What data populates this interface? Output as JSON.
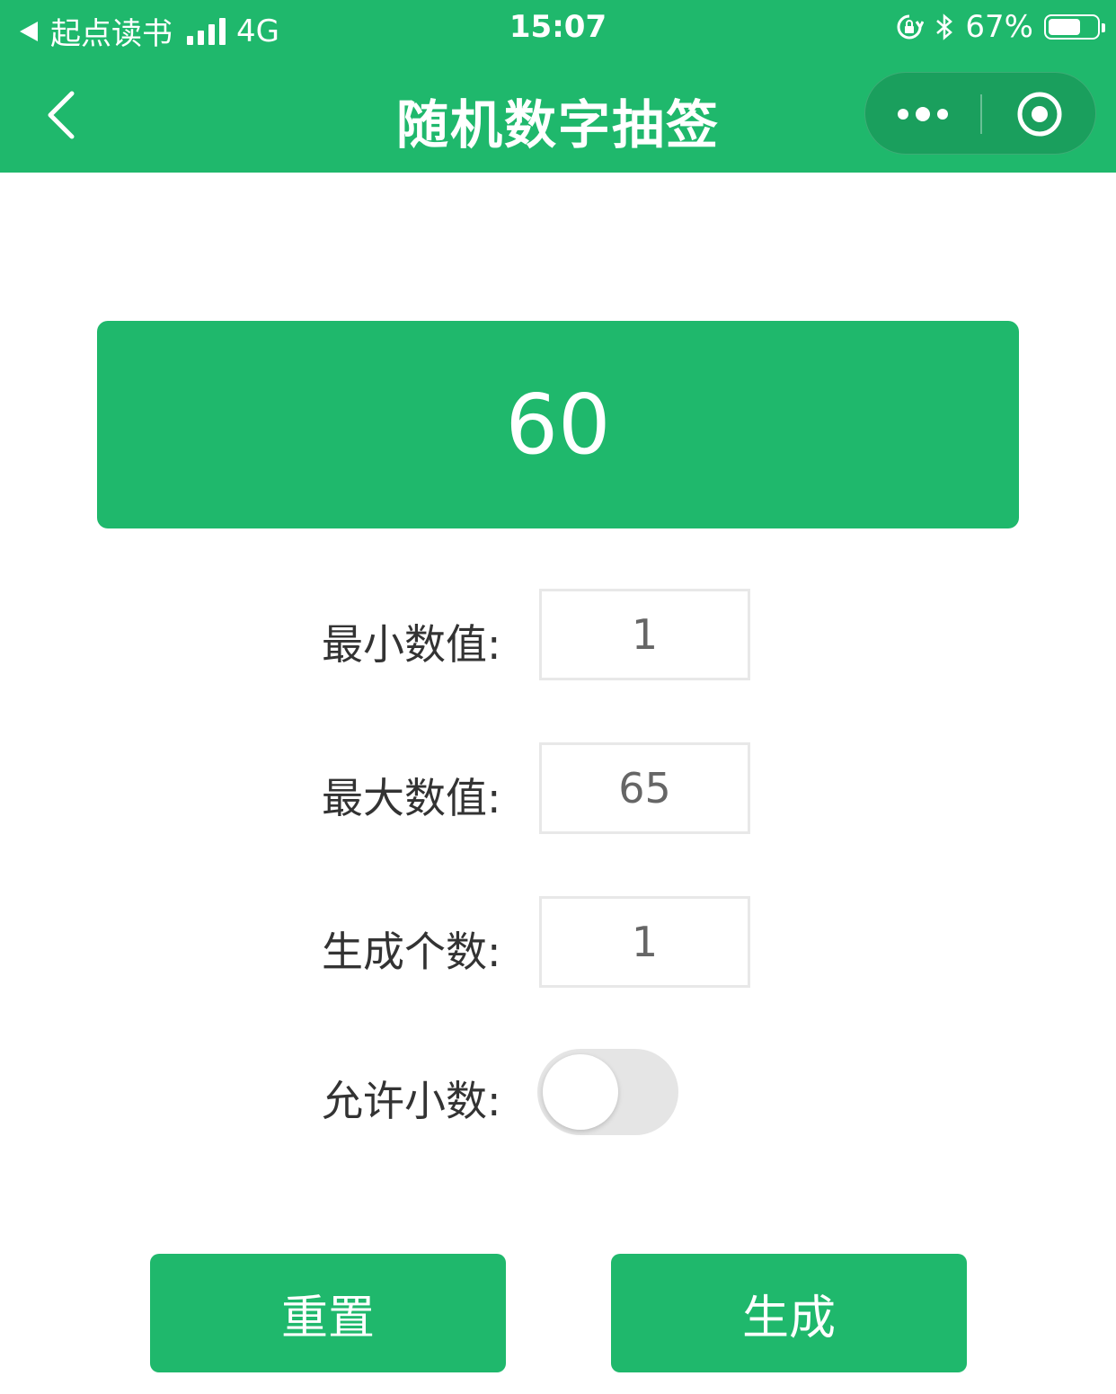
{
  "status_bar": {
    "back_app": "起点读书",
    "network": "4G",
    "time": "15:07",
    "battery": "67%",
    "battery_level": 0.67,
    "icons": [
      "back-triangle-icon",
      "signal-icon",
      "rotation-lock-icon",
      "bluetooth-icon",
      "battery-icon"
    ]
  },
  "nav": {
    "title": "随机数字抽签",
    "icons": [
      "back-chevron-icon",
      "more-icon",
      "close-target-icon"
    ]
  },
  "result": {
    "value": "60"
  },
  "form": {
    "min_label": "最小数值:",
    "min_value": "1",
    "max_label": "最大数值:",
    "max_value": "65",
    "count_label": "生成个数:",
    "count_value": "1",
    "decimal_label": "允许小数:",
    "decimal_enabled": false
  },
  "buttons": {
    "reset": "重置",
    "generate": "生成"
  },
  "colors": {
    "brand_green": "#1fb86c",
    "capsule_green": "#1a9f5d",
    "switch_off": "#e5e5e5"
  }
}
